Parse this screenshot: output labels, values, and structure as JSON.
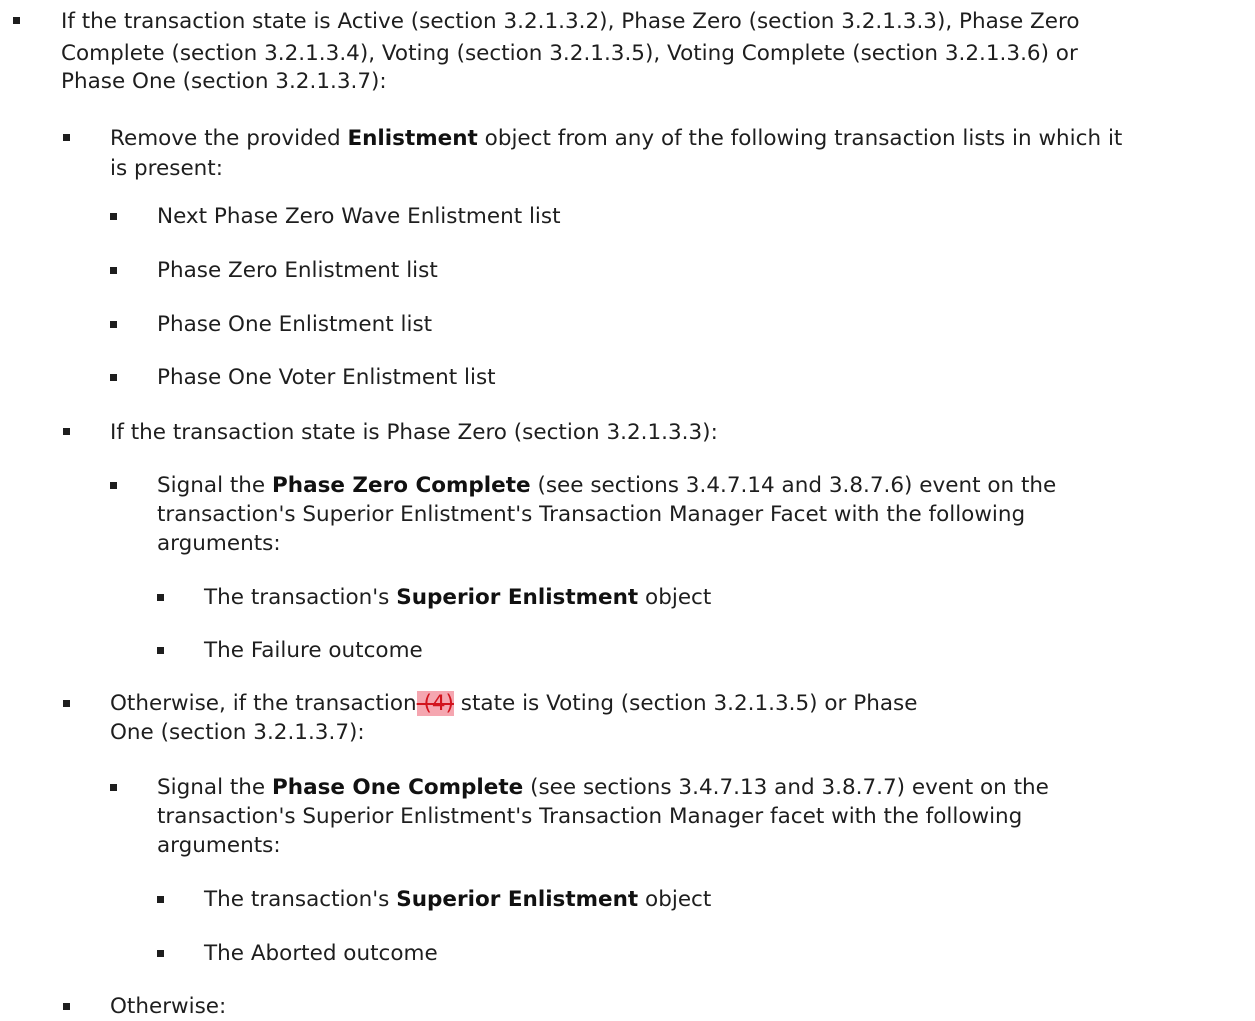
{
  "l1": {
    "line1": "If the transaction state is Active (section 3.2.1.3.2), Phase Zero (section 3.2.1.3.3), Phase Zero",
    "line2": "Complete (section 3.2.1.3.4), Voting (section 3.2.1.3.5), Voting Complete (section 3.2.1.3.6) or",
    "line3": "Phase One (section 3.2.1.3.7):"
  },
  "remove": {
    "before": "Remove the provided ",
    "bold": "Enlistment",
    "after": " object from any of the following transaction lists in which it",
    "line2": "is present:"
  },
  "lists": [
    "Next Phase Zero Wave Enlistment list",
    "Phase Zero Enlistment list",
    "Phase One Enlistment list",
    "Phase One Voter Enlistment list"
  ],
  "pz_if": "If the transaction state is Phase Zero (section 3.2.1.3.3):",
  "pz_signal": {
    "before": "Signal the ",
    "bold": "Phase Zero Complete",
    "after": " (see sections 3.4.7.14 and 3.8.7.6) event on the",
    "line2": "transaction's Superior Enlistment's Transaction Manager Facet with the following",
    "line3": "arguments:"
  },
  "pz_args": {
    "a1_before": "The transaction's ",
    "a1_bold": "Superior Enlistment",
    "a1_after": " object",
    "a2": "The Failure outcome"
  },
  "otherwise_voting": {
    "before": "Otherwise, if the transaction",
    "deleted": " (4)",
    "after": " state is Voting (section 3.2.1.3.5) or Phase",
    "line2": "One (section 3.2.1.3.7):"
  },
  "po_signal": {
    "before": "Signal the ",
    "bold": "Phase One Complete",
    "after": " (see sections 3.4.7.13 and 3.8.7.7) event on the",
    "line2": "transaction's Superior Enlistment's Transaction Manager facet with the following",
    "line3": "arguments:"
  },
  "po_args": {
    "a1_before": "The transaction's ",
    "a1_bold": "Superior Enlistment",
    "a1_after": " object",
    "a2": "The Aborted outcome"
  },
  "otherwise_final": "Otherwise:"
}
